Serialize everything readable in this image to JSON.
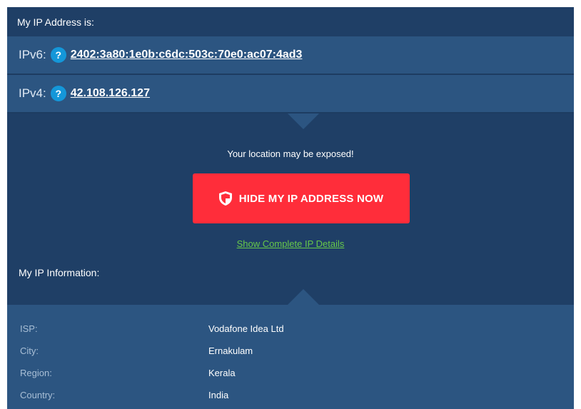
{
  "header": {
    "title": "My IP Address is:"
  },
  "ipv6": {
    "label": "IPv6:",
    "help": "?",
    "address": "2402:3a80:1e0b:c6dc:503c:70e0:ac07:4ad3"
  },
  "ipv4": {
    "label": "IPv4:",
    "help": "?",
    "address": "42.108.126.127"
  },
  "notice": "Your location may be exposed!",
  "hide_button": {
    "label": "HIDE MY IP ADDRESS NOW",
    "icon": "shield-icon"
  },
  "details_link": "Show Complete IP Details",
  "info": {
    "title": "My IP Information:",
    "rows": [
      {
        "key": "ISP:",
        "value": "Vodafone Idea Ltd"
      },
      {
        "key": "City:",
        "value": "Ernakulam"
      },
      {
        "key": "Region:",
        "value": "Kerala"
      },
      {
        "key": "Country:",
        "value": "India"
      }
    ]
  },
  "colors": {
    "panel_bg": "#1f3f66",
    "row_bg": "#2c5581",
    "help_icon": "#1497d9",
    "button": "#ff2d3a",
    "link_green": "#67c84a"
  }
}
